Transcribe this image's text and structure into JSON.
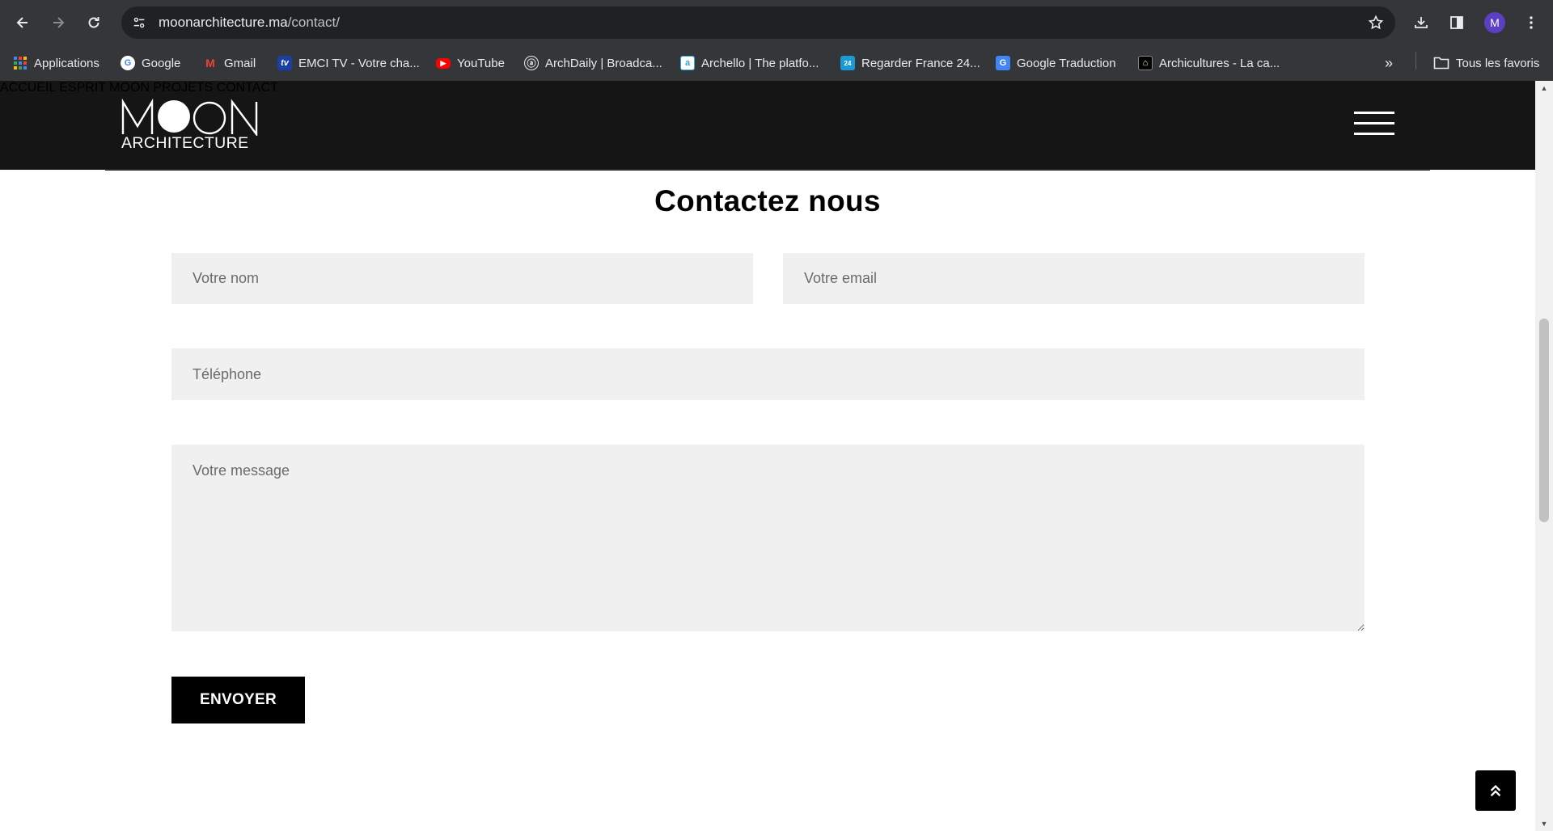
{
  "browser": {
    "url_host": "moonarchitecture.ma",
    "url_path": "/contact/",
    "avatar_letter": "M",
    "bookmarks": [
      {
        "label": "Applications",
        "icon": "apps-grid-icon"
      },
      {
        "label": "Google",
        "icon": "google-icon"
      },
      {
        "label": "Gmail",
        "icon": "gmail-icon"
      },
      {
        "label": "EMCI TV - Votre cha...",
        "icon": "emci-tv-icon"
      },
      {
        "label": "YouTube",
        "icon": "youtube-icon"
      },
      {
        "label": "ArchDaily | Broadca...",
        "icon": "archdaily-icon"
      },
      {
        "label": "Archello | The platfo...",
        "icon": "archello-icon"
      },
      {
        "label": "Regarder France 24...",
        "icon": "france24-icon"
      },
      {
        "label": "Google Traduction",
        "icon": "google-translate-icon"
      },
      {
        "label": "Archicultures - La ca...",
        "icon": "archicultures-icon"
      }
    ],
    "all_bookmarks_label": "Tous les favoris"
  },
  "site": {
    "logo_top": "MOON",
    "logo_bottom": "ARCHITECTURE",
    "nav": [
      "ACCUEIL",
      "ESPRIT MOON",
      "PROJETS",
      "CONTACT"
    ]
  },
  "contact": {
    "title": "Contactez nous",
    "name_placeholder": "Votre nom",
    "email_placeholder": "Votre email",
    "phone_placeholder": "Téléphone",
    "message_placeholder": "Votre message",
    "submit_label": "ENVOYER"
  },
  "colors": {
    "header_bg": "#151515",
    "field_bg": "#f0f0f0",
    "button_bg": "#000000"
  }
}
